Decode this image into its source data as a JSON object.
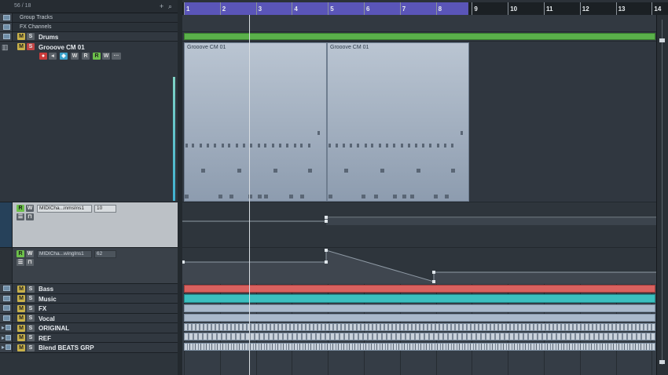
{
  "header": {
    "counter": "56 / 18",
    "add_icon": "+",
    "search_icon": "⌕"
  },
  "tracks": {
    "group_tracks": "Group Tracks",
    "fx_channels": "FX Channels",
    "drums": "Drums",
    "grooove": "Grooove CM 01",
    "bass": "Bass",
    "music": "Music",
    "fx": "FX",
    "vocal": "Vocal",
    "original": "ORIGINAL",
    "ref": "REF",
    "blend": "Blend BEATS GRP"
  },
  "buttons": {
    "mute": "M",
    "solo": "S",
    "read": "R",
    "write": "W"
  },
  "automation1": {
    "param": "MIDICha...inmsIns1",
    "value": "10"
  },
  "automation2": {
    "param": "MIDICha...wingIns1",
    "value": "62"
  },
  "ruler": {
    "bars": [
      "1",
      "2",
      "3",
      "4",
      "5",
      "6",
      "7",
      "8",
      "9",
      "10",
      "11",
      "12",
      "13",
      "14"
    ]
  },
  "parts": {
    "grooove_label_1": "Grooove CM 01",
    "grooove_label_2": "Grooove CM 01"
  },
  "colors": {
    "drums": "#5ab04a",
    "bass": "#d8615f",
    "music": "#3bbfbf",
    "fx": "#a9b9cb",
    "vocal": "#aab9cb",
    "cycle": "#5a55b8",
    "midi_part": "#b9c4d1"
  }
}
